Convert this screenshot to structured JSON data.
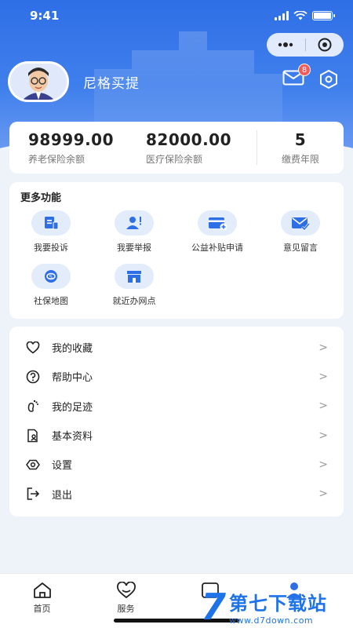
{
  "status_bar": {
    "time": "9:41"
  },
  "profile": {
    "username": "尼格买提",
    "mail_badge": "8"
  },
  "balances": [
    {
      "value": "98999.00",
      "label": "养老保险余额"
    },
    {
      "value": "82000.00",
      "label": "医疗保险余额"
    },
    {
      "value": "5",
      "label": "缴费年限"
    }
  ],
  "more_functions": {
    "title": "更多功能",
    "items": [
      {
        "label": "我要投诉",
        "icon": "complaint-icon"
      },
      {
        "label": "我要举报",
        "icon": "report-icon"
      },
      {
        "label": "公益补贴申请",
        "icon": "subsidy-card-icon"
      },
      {
        "label": "意见留言",
        "icon": "feedback-mail-icon"
      },
      {
        "label": "社保地图",
        "icon": "social-security-map-icon"
      },
      {
        "label": "就近办网点",
        "icon": "nearby-office-icon"
      }
    ]
  },
  "menu": [
    {
      "label": "我的收藏",
      "icon": "heart-icon",
      "arrow": ">"
    },
    {
      "label": "帮助中心",
      "icon": "help-icon",
      "arrow": ">"
    },
    {
      "label": "我的足迹",
      "icon": "footprint-icon",
      "arrow": ">"
    },
    {
      "label": "基本资料",
      "icon": "profile-doc-icon",
      "arrow": ">"
    },
    {
      "label": "设置",
      "icon": "settings-icon",
      "arrow": ">"
    },
    {
      "label": "退出",
      "icon": "logout-icon",
      "arrow": ">"
    }
  ],
  "tabbar": [
    {
      "label": "首页",
      "icon": "home-icon"
    },
    {
      "label": "服务",
      "icon": "service-heart-icon"
    },
    {
      "label": "",
      "icon": "message-icon"
    },
    {
      "label": "",
      "icon": "me-icon"
    }
  ],
  "watermark": {
    "text": "第七下载站",
    "url": "www.d7down.com",
    "logo": "7"
  },
  "colors": {
    "primary": "#2f6fe6",
    "icon_bg": "#e3ecfb",
    "badge": "#f05a5a",
    "background": "#eef2f9"
  }
}
